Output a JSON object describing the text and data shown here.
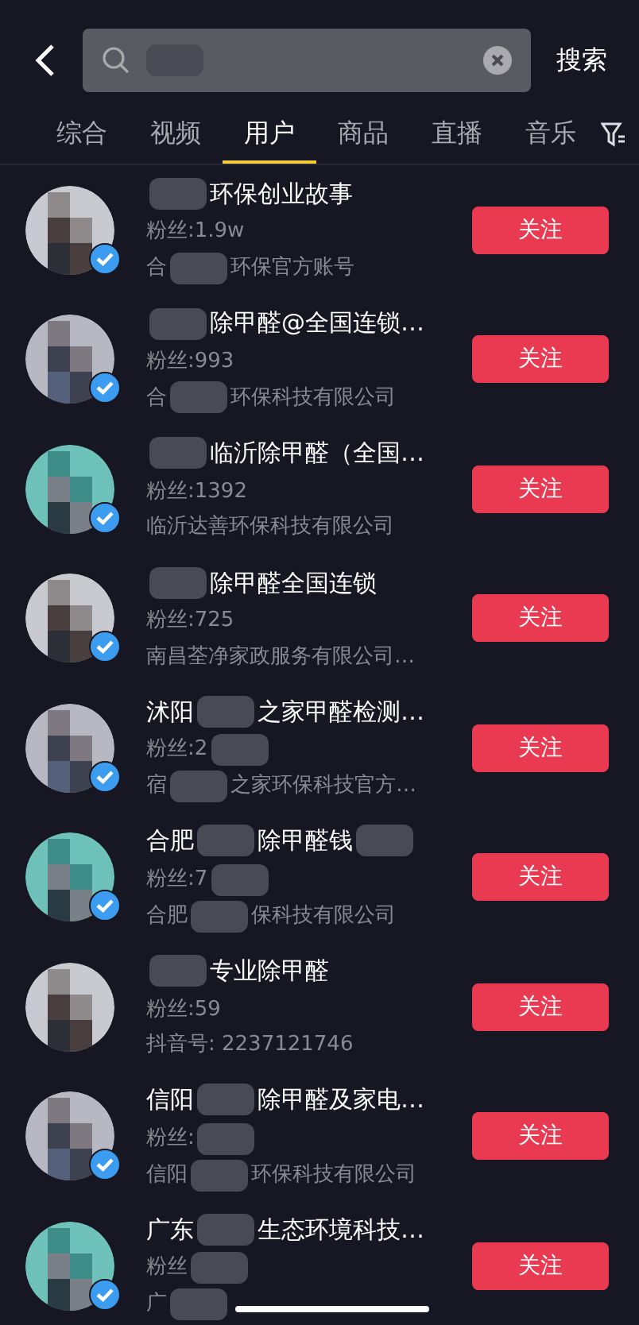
{
  "search": {
    "query": [
      {
        "kind": "hidden"
      }
    ],
    "button": "搜索"
  },
  "tabs": [
    {
      "label": "综合",
      "selected": false
    },
    {
      "label": "视频",
      "selected": false
    },
    {
      "label": "用户",
      "selected": true
    },
    {
      "label": "商品",
      "selected": false
    },
    {
      "label": "直播",
      "selected": false
    },
    {
      "label": "音乐",
      "selected": false
    }
  ],
  "users": [
    {
      "name": [
        {
          "kind": "hidden"
        },
        {
          "kind": "text",
          "text": "环保创业故事"
        }
      ],
      "fans": [
        {
          "kind": "text",
          "text": "粉丝:1.9w"
        }
      ],
      "info": [
        {
          "kind": "text",
          "text": "合"
        },
        {
          "kind": "hidden"
        },
        {
          "kind": "text",
          "text": "环保官方账号"
        }
      ],
      "verified": true,
      "follow": "关注"
    },
    {
      "name": [
        {
          "kind": "hidden"
        },
        {
          "kind": "text",
          "text": "除甲醛@全国连锁…"
        }
      ],
      "fans": [
        {
          "kind": "text",
          "text": "粉丝:993"
        }
      ],
      "info": [
        {
          "kind": "text",
          "text": "合"
        },
        {
          "kind": "hidden"
        },
        {
          "kind": "text",
          "text": "环保科技有限公司"
        }
      ],
      "verified": true,
      "follow": "关注"
    },
    {
      "name": [
        {
          "kind": "hidden"
        },
        {
          "kind": "text",
          "text": "临沂除甲醛（全国…"
        }
      ],
      "fans": [
        {
          "kind": "text",
          "text": "粉丝:1392"
        }
      ],
      "info": [
        {
          "kind": "text",
          "text": "临沂达善环保科技有限公司"
        }
      ],
      "verified": true,
      "follow": "关注"
    },
    {
      "name": [
        {
          "kind": "hidden"
        },
        {
          "kind": "text",
          "text": "除甲醛全国连锁"
        }
      ],
      "fans": [
        {
          "kind": "text",
          "text": "粉丝:725"
        }
      ],
      "info": [
        {
          "kind": "text",
          "text": "南昌荃净家政服务有限公司…"
        }
      ],
      "verified": true,
      "follow": "关注"
    },
    {
      "name": [
        {
          "kind": "text",
          "text": "沭阳"
        },
        {
          "kind": "hidden"
        },
        {
          "kind": "text",
          "text": "之家甲醛检测…"
        }
      ],
      "fans": [
        {
          "kind": "text",
          "text": "粉丝:2"
        },
        {
          "kind": "hidden"
        }
      ],
      "info": [
        {
          "kind": "text",
          "text": "宿"
        },
        {
          "kind": "hidden"
        },
        {
          "kind": "text",
          "text": "之家环保科技官方…"
        }
      ],
      "verified": true,
      "follow": "关注"
    },
    {
      "name": [
        {
          "kind": "text",
          "text": "合肥"
        },
        {
          "kind": "hidden"
        },
        {
          "kind": "text",
          "text": "除甲醛钱"
        },
        {
          "kind": "hidden"
        }
      ],
      "fans": [
        {
          "kind": "text",
          "text": "粉丝:7"
        },
        {
          "kind": "hidden"
        }
      ],
      "info": [
        {
          "kind": "text",
          "text": "合肥"
        },
        {
          "kind": "hidden"
        },
        {
          "kind": "text",
          "text": "保科技有限公司"
        }
      ],
      "verified": true,
      "follow": "关注"
    },
    {
      "name": [
        {
          "kind": "hidden"
        },
        {
          "kind": "text",
          "text": "专业除甲醛"
        }
      ],
      "fans": [
        {
          "kind": "text",
          "text": "粉丝:59"
        }
      ],
      "info": [
        {
          "kind": "text",
          "text": "抖音号: 2237121746"
        }
      ],
      "verified": false,
      "follow": "关注"
    },
    {
      "name": [
        {
          "kind": "text",
          "text": "信阳"
        },
        {
          "kind": "hidden"
        },
        {
          "kind": "text",
          "text": "除甲醛及家电…"
        }
      ],
      "fans": [
        {
          "kind": "text",
          "text": "粉丝:"
        },
        {
          "kind": "hidden"
        }
      ],
      "info": [
        {
          "kind": "text",
          "text": "信阳"
        },
        {
          "kind": "hidden"
        },
        {
          "kind": "text",
          "text": "环保科技有限公司"
        }
      ],
      "verified": true,
      "follow": "关注"
    },
    {
      "name": [
        {
          "kind": "text",
          "text": "广东"
        },
        {
          "kind": "hidden"
        },
        {
          "kind": "text",
          "text": "生态环境科技…"
        }
      ],
      "fans": [
        {
          "kind": "text",
          "text": "粉丝"
        },
        {
          "kind": "hidden"
        }
      ],
      "info": [
        {
          "kind": "text",
          "text": "广"
        },
        {
          "kind": "hidden"
        }
      ],
      "verified": true,
      "follow": "关注"
    }
  ]
}
